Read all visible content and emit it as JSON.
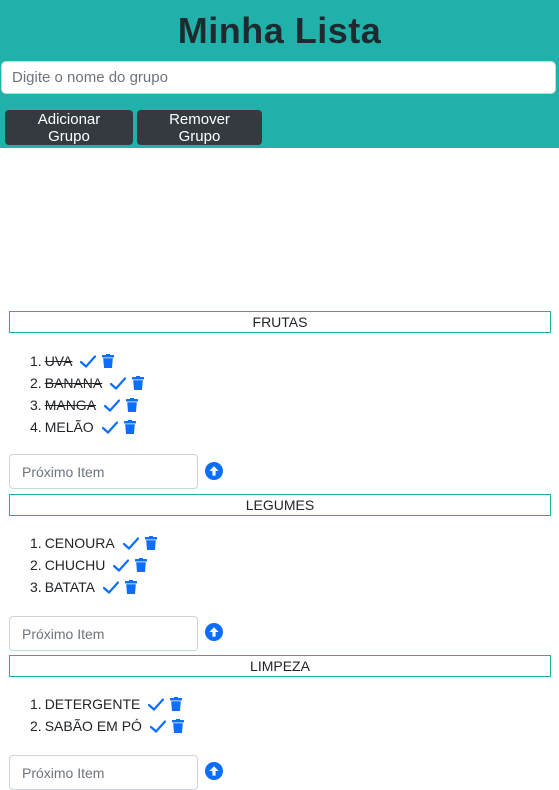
{
  "app": {
    "title": "Minha Lista",
    "group_input_placeholder": "Digite o nome do grupo",
    "add_group_label": "Adicionar Grupo",
    "remove_group_label": "Remover Grupo"
  },
  "colors": {
    "header_bg": "#20b2aa",
    "button_bg": "#343a40",
    "accent": "#0d6efd"
  },
  "groups": [
    {
      "name": "FRUTAS",
      "items": [
        {
          "num": "1.",
          "text": "UVA",
          "done": true
        },
        {
          "num": "2.",
          "text": "BANANA",
          "done": true
        },
        {
          "num": "3.",
          "text": "MANGA",
          "done": true
        },
        {
          "num": "4.",
          "text": "MELÃO",
          "done": false
        }
      ],
      "next_placeholder": "Próximo Item"
    },
    {
      "name": "LEGUMES",
      "items": [
        {
          "num": "1.",
          "text": "CENOURA",
          "done": false
        },
        {
          "num": "2.",
          "text": "CHUCHU",
          "done": false
        },
        {
          "num": "3.",
          "text": "BATATA",
          "done": false
        }
      ],
      "next_placeholder": "Próximo Item"
    },
    {
      "name": "LIMPEZA",
      "items": [
        {
          "num": "1.",
          "text": "DETERGENTE",
          "done": false
        },
        {
          "num": "2.",
          "text": "SABÃO EM PÓ",
          "done": false
        }
      ],
      "next_placeholder": "Próximo Item"
    }
  ],
  "icons": {
    "check": "check-icon",
    "delete": "trash-icon",
    "add_item": "arrow-up-circle-icon"
  }
}
